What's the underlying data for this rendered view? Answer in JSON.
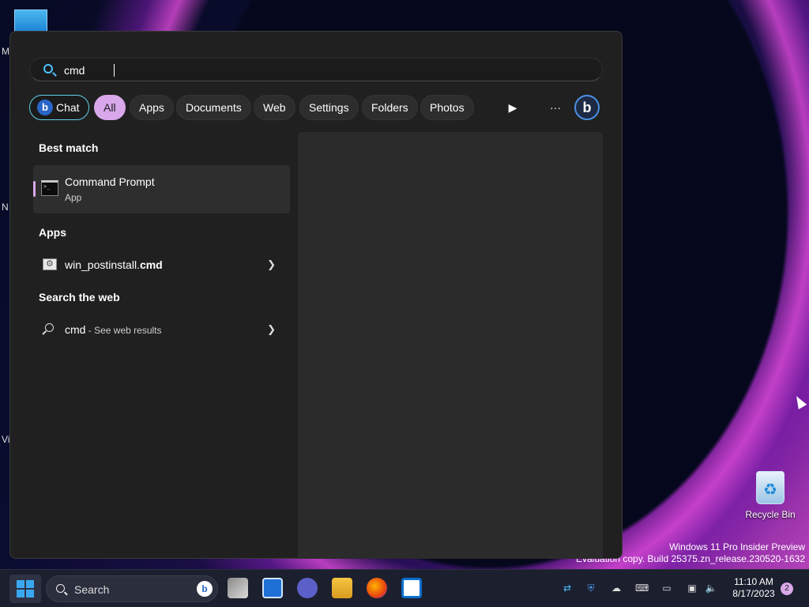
{
  "desktop": {
    "letters": [
      "M",
      "N",
      "Vi"
    ],
    "recycle_bin_label": "Recycle Bin",
    "watermark_line1": "Windows 11 Pro Insider Preview",
    "watermark_line2": "Evaluation copy. Build 25375.zn_release.230520-1632"
  },
  "search": {
    "query": "cmd",
    "filters": [
      "Chat",
      "All",
      "Apps",
      "Documents",
      "Web",
      "Settings",
      "Folders",
      "Photos"
    ],
    "active_filter": "All",
    "more_label": "···",
    "play_label": "▶"
  },
  "results": {
    "best_match_title": "Best match",
    "best_match_name": "Command Prompt",
    "best_match_type": "App",
    "apps_title": "Apps",
    "app_item_prefix": "win_postinstall.",
    "app_item_ext": "cmd",
    "web_title": "Search the web",
    "web_query": "cmd",
    "web_suffix": " - See web results"
  },
  "taskbar": {
    "search_label": "Search",
    "time": "11:10 AM",
    "date": "8/17/2023",
    "notification_count": "2"
  },
  "colors": {
    "accent": "#d9a8ea",
    "chat_border": "#5fd0e8",
    "search_icon": "#4cc2ff"
  }
}
